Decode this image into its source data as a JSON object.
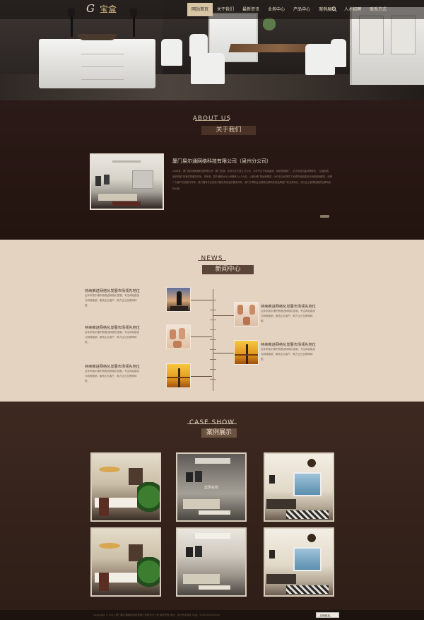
{
  "logo": {
    "text": "G",
    "mark": "宝盒"
  },
  "nav": {
    "items": [
      {
        "label": "网站首页",
        "active": true
      },
      {
        "label": "关于我们",
        "active": false
      },
      {
        "label": "最新资讯",
        "active": false
      },
      {
        "label": "业务中心",
        "active": false
      },
      {
        "label": "产品中心",
        "active": false
      },
      {
        "label": "案例展示",
        "active": false
      },
      {
        "label": "人才招聘",
        "active": false
      },
      {
        "label": "联系方式",
        "active": false
      }
    ],
    "search_icon": "search-icon"
  },
  "about": {
    "title_en": "ABOUT US",
    "title_cn": "关于我们",
    "company": "厦门易尔通网络科技有限公司（泉州分公司）",
    "body": "2006年，厦门易尔通网络科技有限公司（厦门总部）在泉州正式成立分公司。公司专注于网站建设、网络营销推广、企业信息化建设等服务。“注重品质，追求卓越”是我们的服务宗旨。多年来，易尔通泉州分公司秉承“以人为本、以客为尊”的经营理念，为众多企业提供了优质的网站建设与网络营销服务，深受广大客户的信赖与好评。我们拥有专业的技术团队和完善的服务体系，致力于帮助企业借助互联网实现品牌推广和业务增长，成为企业值得信赖的互联网合作伙伴。"
  },
  "news": {
    "title_en": "NEWS",
    "title_cn": "新闻中心",
    "items": [
      {
        "title": "持续推进网络化发展市场领先地位",
        "body": "近年来易尔通不断推进网络化发展，专注网站建设与网络营销，服务企业客户，助力企业互联网转型。"
      },
      {
        "title": "持续推进网络化发展市场领先地位",
        "body": "近年来易尔通不断推进网络化发展，专注网站建设与网络营销，服务企业客户，助力企业互联网转型。"
      },
      {
        "title": "持续推进网络化发展市场领先地位",
        "body": "近年来易尔通不断推进网络化发展，专注网站建设与网络营销，服务企业客户，助力企业互联网转型。"
      },
      {
        "title": "持续推进网络化发展市场领先地位",
        "body": "近年来易尔通不断推进网络化发展，专注网站建设与网络营销，服务企业客户，助力企业互联网转型。"
      },
      {
        "title": "持续推进网络化发展市场领先地位",
        "body": "近年来易尔通不断推进网络化发展，专注网站建设与网络营销，服务企业客户，助力企业互联网转型。"
      }
    ]
  },
  "cases": {
    "title_en": "CASE SHOW",
    "title_cn": "案例展示",
    "hover_label": "案例名称"
  },
  "footer": {
    "text": "Copyright © 2015 厦门易尔通网络科技有限公司泉州分公司 版权所有 地址：泉州市丰泽区 电话：0595-XXXXXXXX",
    "select": "--友情链接--"
  }
}
